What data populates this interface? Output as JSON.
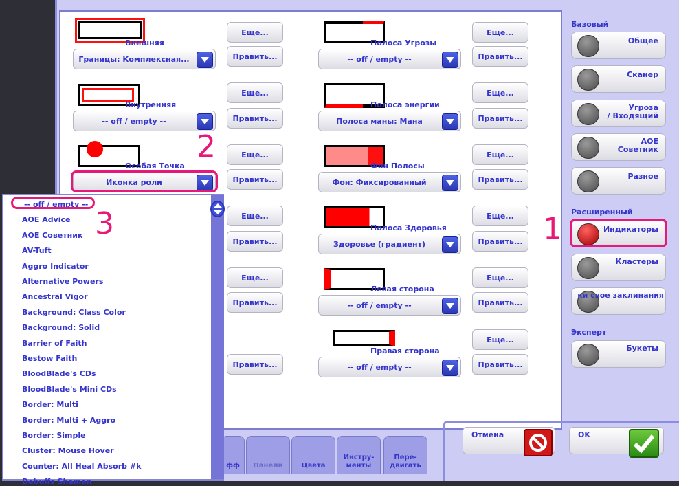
{
  "left_column": [
    {
      "label": "Внешняя",
      "dropdown": "Границы: Комплексная...",
      "more": "Еще...",
      "edit": "Править..."
    },
    {
      "label": "Внутренняя",
      "dropdown": "-- off / empty --",
      "more": "Еще...",
      "edit": "Править..."
    },
    {
      "label": "Особая Точка",
      "dropdown": "Иконка роли",
      "more": "Еще...",
      "edit": "Править..."
    }
  ],
  "left_hidden_buttons": {
    "more": "Еще...",
    "edit": "Править..."
  },
  "right_column": [
    {
      "label": "Полоса Угрозы",
      "dropdown": "-- off / empty --",
      "more": "Еще...",
      "edit": "Править..."
    },
    {
      "label": "Полоса энергии",
      "dropdown": "Полоса маны: Мана",
      "more": "Еще...",
      "edit": "Править..."
    },
    {
      "label": "Фон Полосы",
      "dropdown": "Фон: Фиксированный",
      "more": "Еще...",
      "edit": "Править..."
    },
    {
      "label": "Полоса Здоровья",
      "dropdown": "Здоровье (градиент)",
      "more": "Еще...",
      "edit": "Править..."
    },
    {
      "label": "Левая сторона",
      "dropdown": "-- off / empty --",
      "more": "Еще...",
      "edit": "Править..."
    },
    {
      "label": "Правая сторона",
      "dropdown": "-- off / empty --",
      "more": "Еще...",
      "edit": "Править..."
    }
  ],
  "sidebar": {
    "basic_title": "Базовый",
    "basic": [
      "Общее",
      "Сканер",
      "Угроза\n/ Входящий",
      "AOE\nСоветник",
      "Разное"
    ],
    "advanced_title": "Расширенный",
    "advanced": [
      "Индикаторы",
      "Кластеры",
      "ки свое заклинания"
    ],
    "expert_title": "Эксперт",
    "expert": [
      "Букеты"
    ]
  },
  "footer": {
    "cancel": "Отмена",
    "ok": "OK"
  },
  "tabs": [
    "фф",
    "Панели",
    "Цвета",
    "Инстру-\nменты",
    "Пере-\nдвигать"
  ],
  "dropdown_list": [
    "-- off / empty --",
    "AOE Advice",
    "AOE Советник",
    "AV-Tuft",
    "Aggro Indicator",
    "Alternative Powers",
    "Ancestral Vigor",
    "Background: Class Color",
    "Background: Solid",
    "Barrier of Faith",
    "Bestow Faith",
    "BloodBlade's CDs",
    "BloodBlade's Mini CDs",
    "Border: Multi",
    "Border: Multi + Aggro",
    "Border: Simple",
    "Cluster: Mouse Hover",
    "Counter: All Heal Absorb #k",
    "Debuffs Shaman"
  ],
  "annotations": [
    "1",
    "2",
    "3"
  ],
  "colors": {
    "accent": "#3535cc",
    "annotation": "#e8187a",
    "red": "#ff0000",
    "pink": "#ff8a8a"
  }
}
